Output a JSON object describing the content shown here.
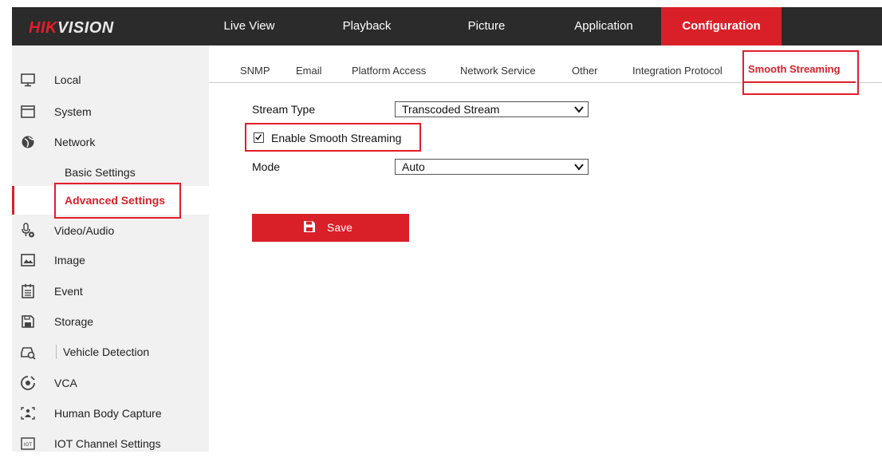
{
  "header": {
    "logo": {
      "part1": "HIK",
      "part2": "VISION"
    },
    "nav": [
      {
        "label": "Live View",
        "active": false
      },
      {
        "label": "Playback",
        "active": false
      },
      {
        "label": "Picture",
        "active": false
      },
      {
        "label": "Application",
        "active": false
      },
      {
        "label": "Configuration",
        "active": true
      }
    ]
  },
  "sidebar": {
    "items": [
      {
        "label": "Local",
        "icon": "monitor-icon"
      },
      {
        "label": "System",
        "icon": "system-icon"
      },
      {
        "label": "Network",
        "icon": "network-icon"
      },
      {
        "label": "Basic Settings"
      },
      {
        "label": "Advanced Settings",
        "active": true
      },
      {
        "label": "Video/Audio",
        "icon": "video-audio-icon"
      },
      {
        "label": "Image",
        "icon": "image-icon"
      },
      {
        "label": "Event",
        "icon": "event-icon"
      },
      {
        "label": "Storage",
        "icon": "storage-icon"
      },
      {
        "label": "Vehicle Detection",
        "icon": "vehicle-detection-icon"
      },
      {
        "label": "VCA",
        "icon": "vca-icon"
      },
      {
        "label": "Human Body Capture",
        "icon": "human-body-icon"
      },
      {
        "label": "IOT Channel Settings",
        "icon": "iot-icon",
        "icon_text": "IOT"
      }
    ]
  },
  "tabs": [
    {
      "label": "SNMP"
    },
    {
      "label": "Email"
    },
    {
      "label": "Platform Access"
    },
    {
      "label": "Network Service"
    },
    {
      "label": "Other"
    },
    {
      "label": "Integration Protocol"
    },
    {
      "label": "Smooth Streaming",
      "active": true
    }
  ],
  "form": {
    "stream_type_label": "Stream Type",
    "stream_type_value": "Transcoded Stream",
    "enable_label": "Enable Smooth Streaming",
    "enable_checked": true,
    "mode_label": "Mode",
    "mode_value": "Auto",
    "save_label": "Save"
  },
  "colors": {
    "accent": "#d92029",
    "topbar": "#2b2b2b",
    "sidebar_bg": "#f1f1f1",
    "highlight_box": "#e41d2b"
  }
}
